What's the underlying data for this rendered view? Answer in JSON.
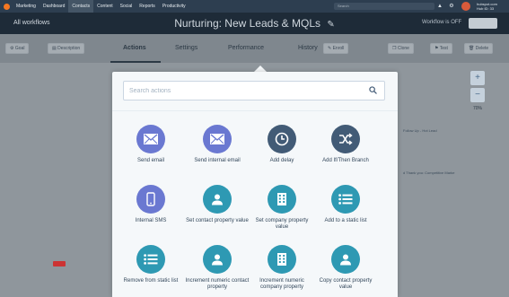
{
  "topnav": {
    "items": [
      "Marketing",
      "Dashboard",
      "Contacts",
      "Content",
      "Social",
      "Reports",
      "Productivity"
    ],
    "search_placeholder": "Search",
    "portal_line1": "hubspot.com",
    "portal_line2": "Hub ID: 33"
  },
  "header": {
    "back_label": "All workflows",
    "title": "Nurturing: New Leads & MQLs",
    "status": "Workflow is OFF"
  },
  "toolbar": {
    "goal_label": "Goal",
    "description_label": "Description",
    "tabs": [
      "Actions",
      "Settings",
      "Performance",
      "History"
    ],
    "enroll_label": "Enroll",
    "clone_label": "Clone",
    "test_label": "Test",
    "delete_label": "Delete"
  },
  "canvas": {
    "zoom_level": "70%",
    "side_text_1": "Follow Up - Hot Lead",
    "side_text_2": "d Thank you: Competitive Marke"
  },
  "modal": {
    "search_placeholder": "Search actions",
    "actions": [
      {
        "label": "Send email",
        "icon": "envelope-icon",
        "color": "#6a78d1"
      },
      {
        "label": "Send internal email",
        "icon": "envelope-icon",
        "color": "#6a78d1"
      },
      {
        "label": "Add delay",
        "icon": "clock-icon",
        "color": "#425b76"
      },
      {
        "label": "Add If/Then Branch",
        "icon": "shuffle-icon",
        "color": "#425b76"
      },
      {
        "label": "Internal SMS",
        "icon": "phone-icon",
        "color": "#6a78d1"
      },
      {
        "label": "Set contact property value",
        "icon": "person-icon",
        "color": "#2e99b3"
      },
      {
        "label": "Set company property value",
        "icon": "building-icon",
        "color": "#2e99b3"
      },
      {
        "label": "Add to a static list",
        "icon": "list-icon",
        "color": "#2e99b3"
      },
      {
        "label": "Remove from static list",
        "icon": "list-icon",
        "color": "#2e99b3"
      },
      {
        "label": "Increment numeric contact property",
        "icon": "person-icon",
        "color": "#2e99b3"
      },
      {
        "label": "Increment numeric company property",
        "icon": "building-icon",
        "color": "#2e99b3"
      },
      {
        "label": "Copy contact property value",
        "icon": "person-icon",
        "color": "#2e99b3"
      }
    ]
  }
}
